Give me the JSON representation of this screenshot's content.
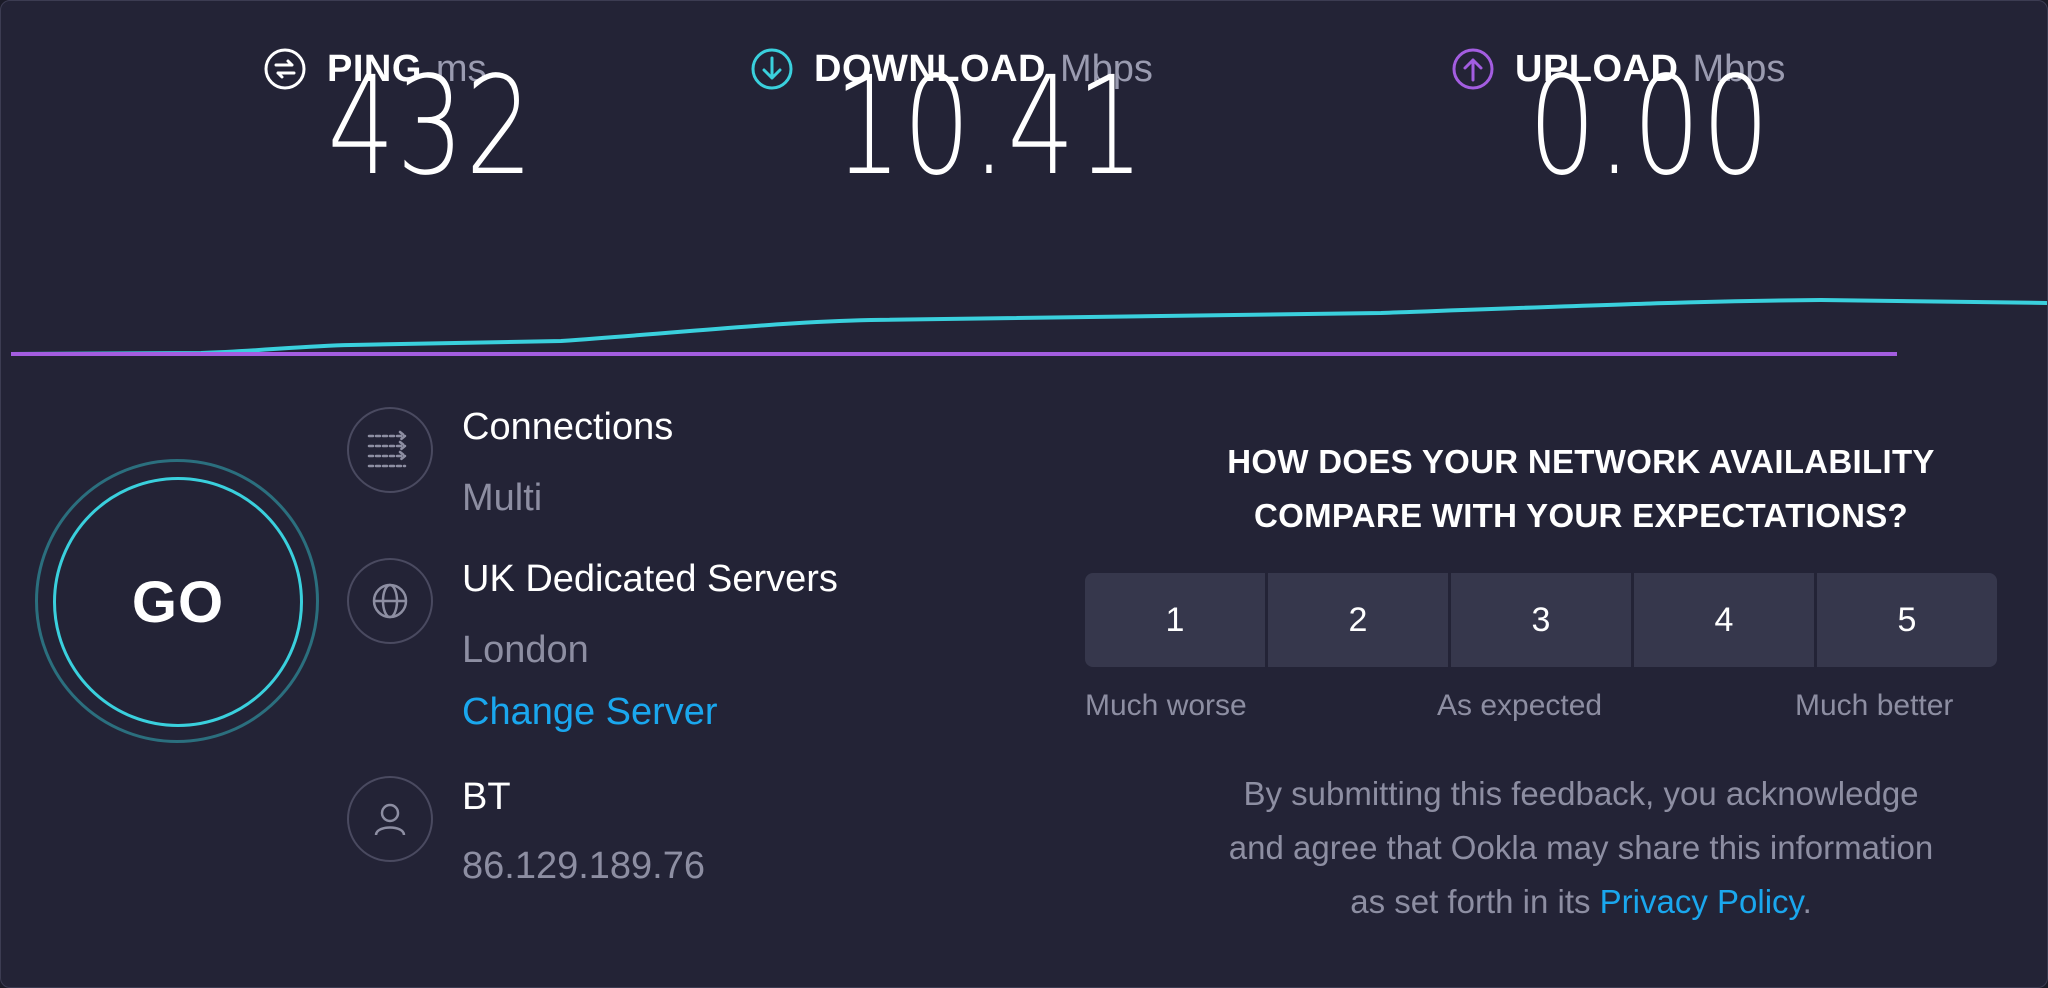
{
  "metrics": {
    "ping": {
      "label": "PING",
      "unit": "ms",
      "value": "432",
      "icon": "ping-icon"
    },
    "download": {
      "label": "DOWNLOAD",
      "unit": "Mbps",
      "value": "10.41",
      "icon": "download-arrow-icon"
    },
    "upload": {
      "label": "UPLOAD",
      "unit": "Mbps",
      "value": "0.00",
      "icon": "upload-arrow-icon"
    }
  },
  "go_button": {
    "label": "GO"
  },
  "connections": {
    "title": "Connections",
    "value": "Multi",
    "icon": "connections-icon"
  },
  "server": {
    "name": "UK Dedicated Servers",
    "location": "London",
    "change_label": "Change Server",
    "icon": "globe-icon"
  },
  "provider": {
    "name": "BT",
    "ip": "86.129.189.76",
    "icon": "user-icon"
  },
  "feedback": {
    "question_line1": "HOW DOES YOUR NETWORK AVAILABILITY",
    "question_line2": "COMPARE WITH YOUR EXPECTATIONS?",
    "ratings": [
      "1",
      "2",
      "3",
      "4",
      "5"
    ],
    "low_label": "Much worse",
    "mid_label": "As expected",
    "high_label": "Much better",
    "disclaimer_line1": "By submitting this feedback, you acknowledge",
    "disclaimer_line2": "and agree that Ookla may share this information",
    "disclaimer_line3": "as set forth in its",
    "privacy_link": "Privacy Policy",
    "disclaimer_end": "."
  },
  "colors": {
    "background": "#232336",
    "download_accent": "#3ad0dd",
    "upload_accent": "#a35de0",
    "link": "#1aa7ee",
    "muted_text": "#8d8ea2"
  }
}
